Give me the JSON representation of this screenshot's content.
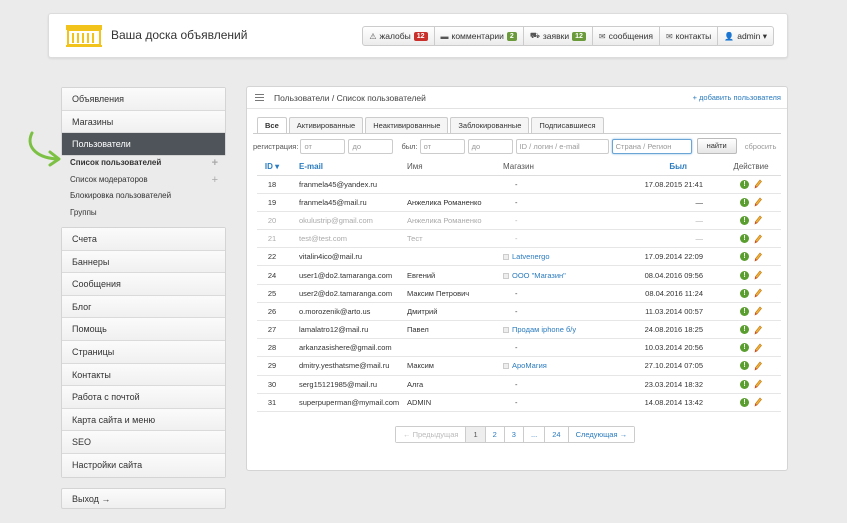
{
  "header": {
    "brand": "Ваша доска объявлений",
    "nav": [
      {
        "icon": "warning-icon",
        "glyph": "⚠",
        "label": "жалобы",
        "badge": "12",
        "badge_color": "#c9302c"
      },
      {
        "icon": "comment-icon",
        "glyph": "▬",
        "label": "комментарии",
        "badge": "2",
        "badge_color": "#6a9a3a"
      },
      {
        "icon": "cart-icon",
        "glyph": "⛟",
        "label": "заявки",
        "badge": "12",
        "badge_color": "#6a9a3a"
      },
      {
        "icon": "mail-icon",
        "glyph": "✉",
        "label": "сообщения",
        "badge": "",
        "badge_color": ""
      },
      {
        "icon": "contacts-icon",
        "glyph": "✉",
        "label": "контакты",
        "badge": "",
        "badge_color": ""
      },
      {
        "icon": "user-icon",
        "glyph": "👤",
        "label": "admin ▾",
        "badge": "",
        "badge_color": ""
      }
    ]
  },
  "sidebar": {
    "group1": [
      "Объявления",
      "Магазины",
      "Пользователи"
    ],
    "active": "Пользователи",
    "submenu": [
      {
        "label": "Список пользователей",
        "current": true,
        "plus": true
      },
      {
        "label": "Список модераторов",
        "current": false,
        "plus": true
      },
      {
        "label": "Блокировка пользователей",
        "current": false,
        "plus": false
      },
      {
        "label": "Группы",
        "current": false,
        "plus": false
      }
    ],
    "group2": [
      "Счета",
      "Баннеры",
      "Сообщения",
      "Блог",
      "Помощь",
      "Страницы",
      "Контакты",
      "Работа с почтой",
      "Карта сайта и меню",
      "SEO",
      "Настройки сайта"
    ],
    "logout": "Выход →"
  },
  "panel": {
    "title": "Пользователи / Список пользователей",
    "add_link": "+ добавить пользователя",
    "tabs": [
      "Все",
      "Активированные",
      "Неактивированные",
      "Заблокированные",
      "Подписавшиеся"
    ],
    "active_tab": "Все",
    "filters": {
      "reg_label": "регистрация:",
      "reg_from": "от",
      "reg_to": "до",
      "was_label": "был:",
      "was_from": "от",
      "was_to": "до",
      "search_placeholder": "ID / логин / e-mail",
      "region_placeholder": "Страна / Регион",
      "find": "найти",
      "reset": "сбросить"
    },
    "columns": {
      "id": "ID ▾",
      "email": "E-mail",
      "name": "Имя",
      "shop": "Магазин",
      "was": "Был",
      "action": "Действие"
    },
    "rows": [
      {
        "id": "18",
        "email": "franmela45@yandex.ru",
        "name": "",
        "shop": "-",
        "shop_link": false,
        "was": "17.08.2015 21:41",
        "muted": false
      },
      {
        "id": "19",
        "email": "franmela45@mail.ru",
        "name": "Анжелика Романенко",
        "shop": "-",
        "shop_link": false,
        "was": "—",
        "muted": false
      },
      {
        "id": "20",
        "email": "okulustrip@gmail.com",
        "name": "Анжелика Романенко",
        "shop": "-",
        "shop_link": false,
        "was": "—",
        "muted": true
      },
      {
        "id": "21",
        "email": "test@test.com",
        "name": "Тест",
        "shop": "-",
        "shop_link": false,
        "was": "—",
        "muted": true
      },
      {
        "id": "22",
        "email": "vitalin4ico@mail.ru",
        "name": "",
        "shop": "Latvenergo",
        "shop_link": true,
        "was": "17.09.2014 22:09",
        "muted": false
      },
      {
        "id": "24",
        "email": "user1@do2.tamaranga.com",
        "name": "Евгений",
        "shop": "ООО \"Магазин\"",
        "shop_link": true,
        "was": "08.04.2016 09:56",
        "muted": false
      },
      {
        "id": "25",
        "email": "user2@do2.tamaranga.com",
        "name": "Максим Петрович",
        "shop": "-",
        "shop_link": false,
        "was": "08.04.2016 11:24",
        "muted": false
      },
      {
        "id": "26",
        "email": "o.morozenik@arto.us",
        "name": "Дмитрий",
        "shop": "-",
        "shop_link": false,
        "was": "11.03.2014 00:57",
        "muted": false
      },
      {
        "id": "27",
        "email": "lamalatro12@mail.ru",
        "name": "Павел",
        "shop": "Продам iphone б/у",
        "shop_link": true,
        "was": "24.08.2016 18:25",
        "muted": false
      },
      {
        "id": "28",
        "email": "arkanzasishere@gmail.com",
        "name": "",
        "shop": "-",
        "shop_link": false,
        "was": "10.03.2014 20:56",
        "muted": false
      },
      {
        "id": "29",
        "email": "dmitry.yesthatsme@mail.ru",
        "name": "Максим",
        "shop": "АроМагия",
        "shop_link": true,
        "was": "27.10.2014 07:05",
        "muted": false
      },
      {
        "id": "30",
        "email": "serg15121985@mail.ru",
        "name": "Алга",
        "shop": "-",
        "shop_link": false,
        "was": "23.03.2014 18:32",
        "muted": false
      },
      {
        "id": "31",
        "email": "superpuperman@mymail.com",
        "name": "ADMIN",
        "shop": "-",
        "shop_link": false,
        "was": "14.08.2014 13:42",
        "muted": false
      }
    ],
    "pager": [
      "← Предыдущая",
      "1",
      "2",
      "3",
      "...",
      "24",
      "Следующая →"
    ],
    "pager_current": "1"
  },
  "colors": {
    "accent": "#2a7bbf",
    "active_bg": "#4e5459",
    "ok_green": "#5a9e2f",
    "arrow_green": "#7cc143"
  }
}
